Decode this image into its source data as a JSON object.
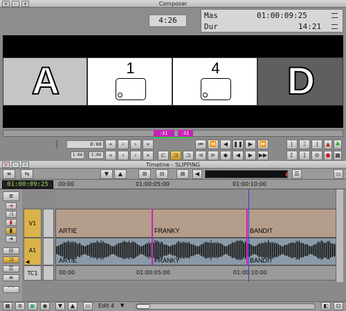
{
  "composer": {
    "title": "Composer",
    "timecode_center": "4:26",
    "mas_label": "Mas",
    "mas_value": "01:00:09:25",
    "dur_label": "Dur",
    "dur_value": "14:21",
    "frames": [
      {
        "letter": "A"
      },
      {
        "number": "1"
      },
      {
        "number": "4"
      },
      {
        "letter": "D"
      }
    ],
    "slip_left": "-31",
    "slip_right": "-31",
    "field_value": "0:00",
    "small_field_1": "1:00",
    "small_field_2": "1:00"
  },
  "timeline": {
    "title": "Timeline - SLIPPING",
    "position_timecode": "01:00:09:25",
    "ruler_labels": [
      "00:00",
      "01:00:05:00",
      "01:00:10:00"
    ],
    "tracks": [
      {
        "label": "V1"
      },
      {
        "label": "A1"
      },
      {
        "label": "TC1"
      }
    ],
    "clips": [
      "ARTIE",
      "FRANKY",
      "BANDIT"
    ],
    "tc_labels": [
      "00:00",
      "01:00:05:00",
      "01:00:10:00"
    ],
    "edit_label": "Edit 4"
  },
  "colors": {
    "accent_magenta": "#c822b8",
    "playhead_blue": "#3a3ae0",
    "video_clip": "#b59d8b",
    "audio_clip": "#8a9aa8",
    "track_label_yellow": "#d9b24a",
    "timecode_green": "#9cd15a"
  }
}
